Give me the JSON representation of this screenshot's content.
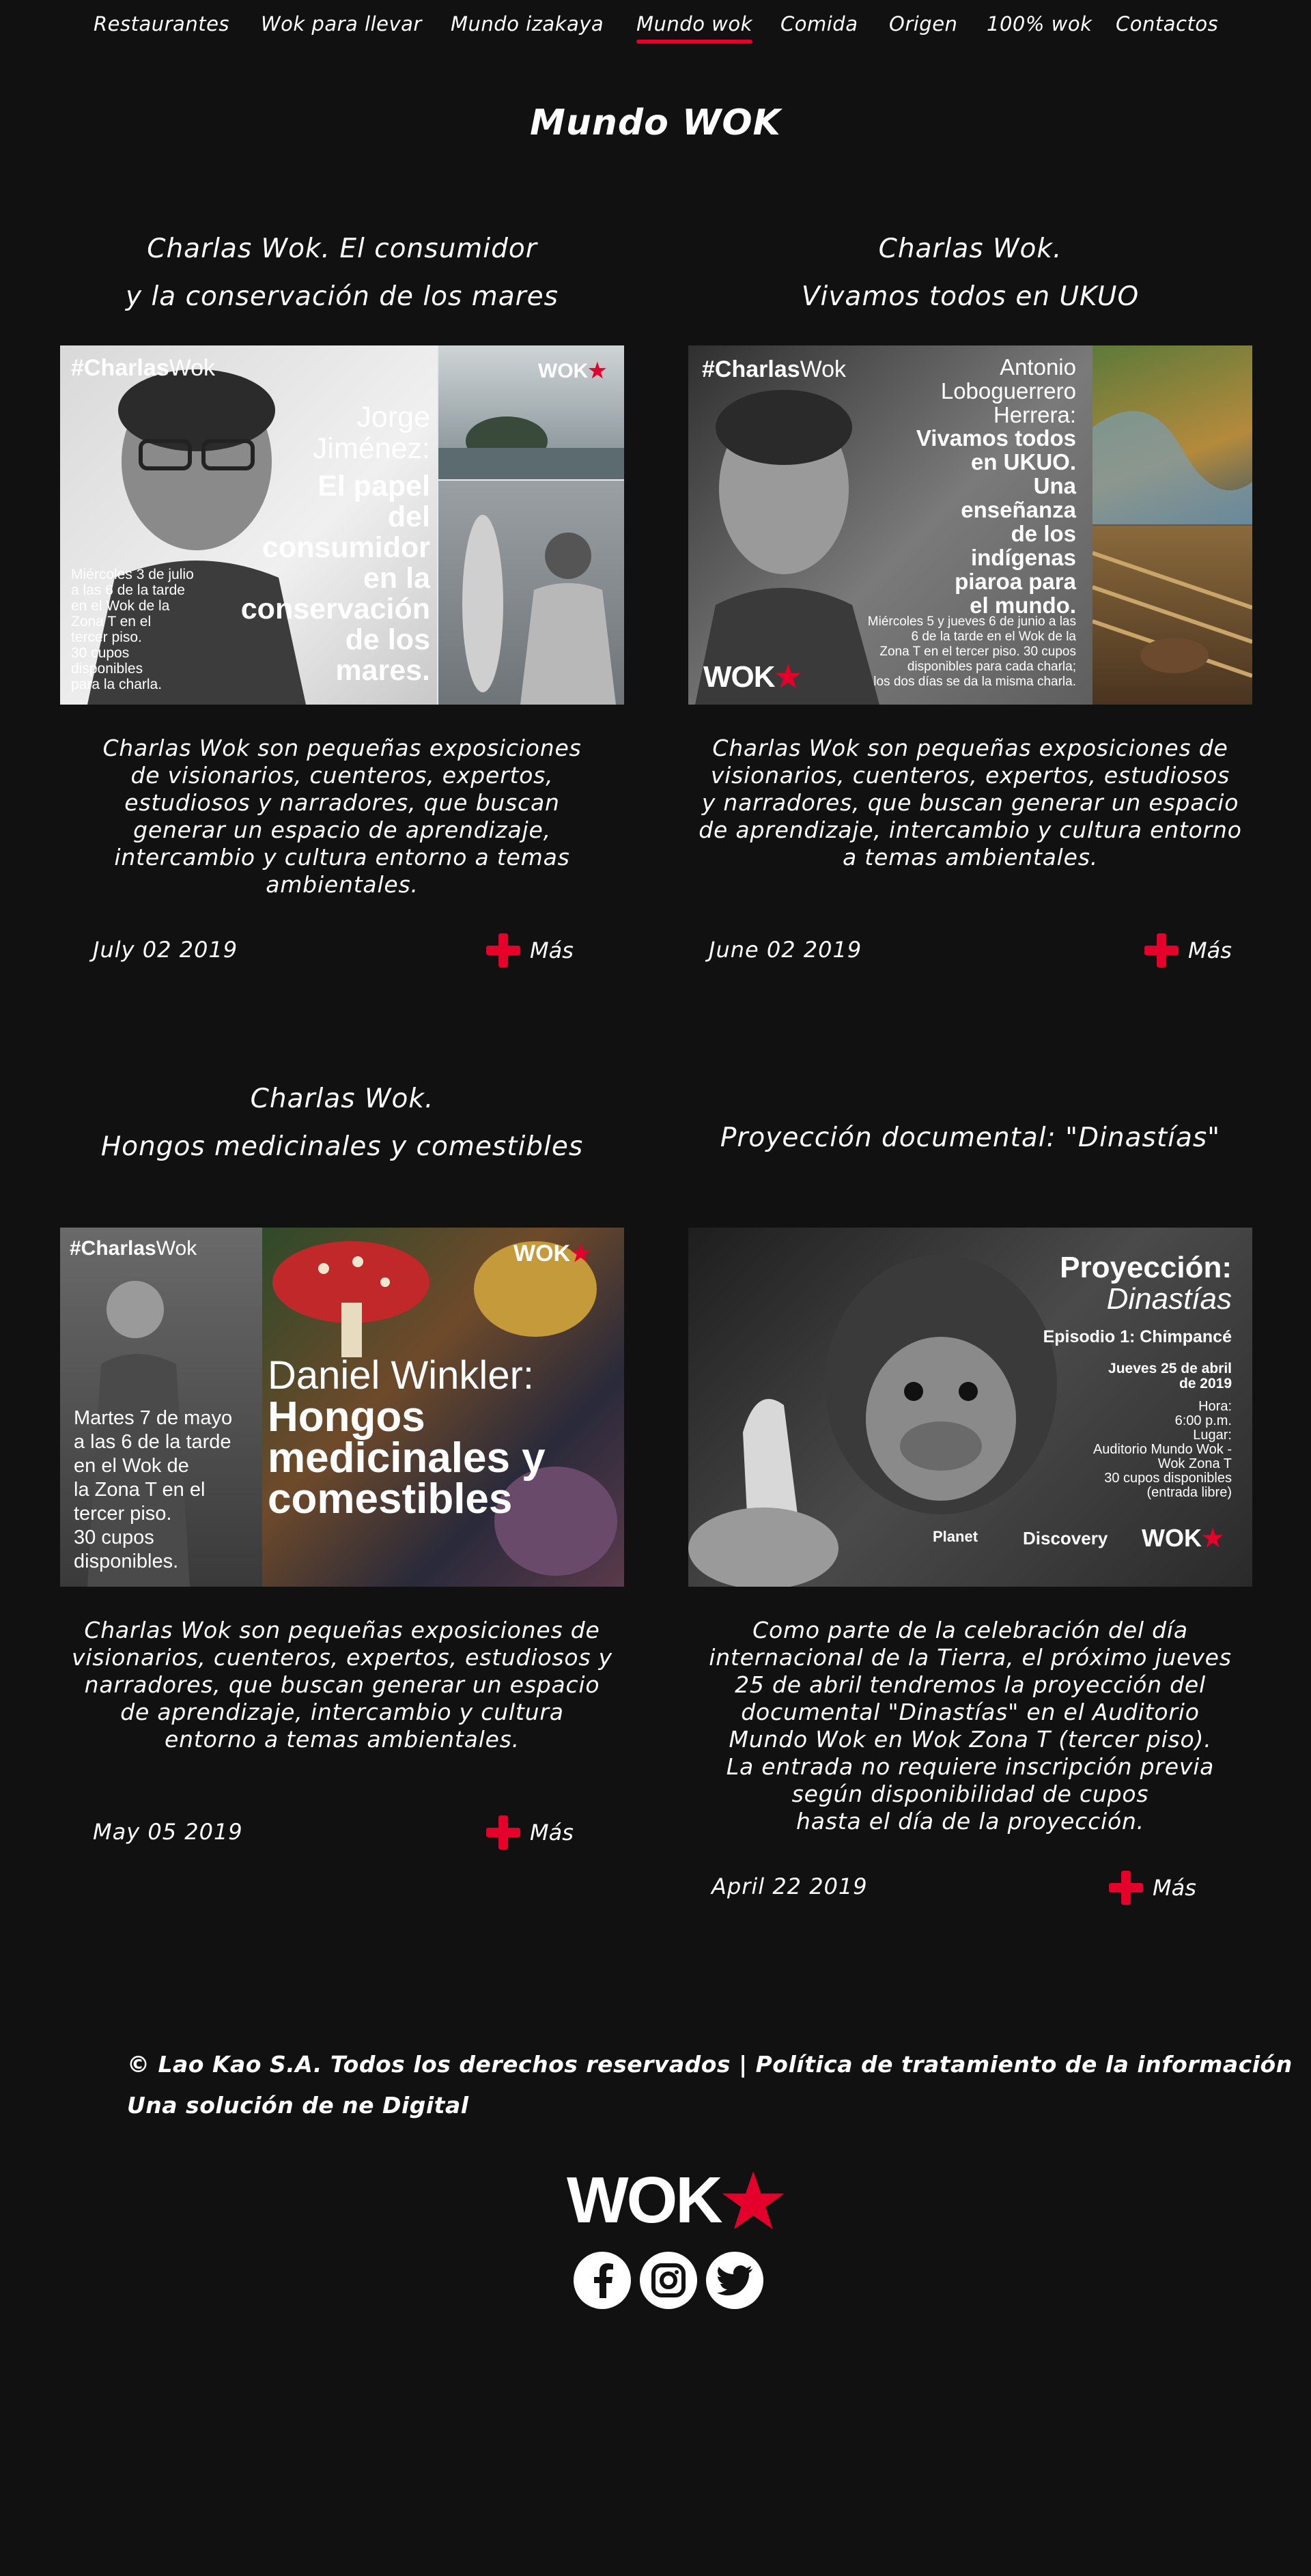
{
  "nav": {
    "items": [
      {
        "label": "Restaurantes"
      },
      {
        "label": "Wok para llevar"
      },
      {
        "label": "Mundo izakaya"
      },
      {
        "label": "Mundo wok",
        "active": true
      },
      {
        "label": "Comida"
      },
      {
        "label": "Origen"
      },
      {
        "label": "100% wok"
      },
      {
        "label": "Contactos"
      }
    ]
  },
  "page": {
    "title": "Mundo WOK"
  },
  "brand": {
    "accent": "#e4002b",
    "background": "#111111",
    "logo": "WOK"
  },
  "cards": [
    {
      "title_lines": [
        "Charlas Wok. El consumidor",
        "y la conservación de los mares"
      ],
      "poster": {
        "tag_bold": "#Charlas",
        "tag_light": "Wok",
        "logo": "WOK",
        "headline_light": [
          "Jorge",
          "Jiménez:"
        ],
        "headline_bold": [
          "El papel",
          "del",
          "consumidor",
          "en la",
          "conservación",
          "de los",
          "mares."
        ],
        "details": [
          "Miércoles 3 de julio",
          "a las 6 de la tarde",
          "en el Wok de la",
          "Zona T en el",
          "tercer piso.",
          "30 cupos",
          "disponibles",
          "para la charla."
        ]
      },
      "desc_lines": [
        "Charlas Wok son pequeñas exposiciones",
        "de visionarios, cuenteros, expertos,",
        "estudiosos y narradores, que buscan",
        "generar un espacio de aprendizaje,",
        "intercambio y cultura entorno a temas",
        "ambientales."
      ],
      "date": "July 02 2019",
      "more": "Más"
    },
    {
      "title_lines": [
        "Charlas Wok.",
        "Vivamos todos en UKUO"
      ],
      "poster": {
        "tag_bold": "#Charlas",
        "tag_light": "Wok",
        "logo": "WOK",
        "headline_light": [
          "Antonio",
          "Loboguerrero",
          "Herrera:"
        ],
        "headline_bold": [
          "Vivamos todos",
          "en UKUO.",
          "Una",
          "enseñanza",
          "de los",
          "indígenas",
          "piaroa para",
          "el mundo."
        ],
        "details": [
          "Miércoles 5 y jueves 6 de junio a las",
          "6 de la tarde en el Wok de la",
          "Zona T en el tercer piso. 30 cupos",
          "disponibles para cada charla;",
          "los dos días se da la misma charla."
        ]
      },
      "desc_lines": [
        "Charlas Wok son pequeñas exposiciones de",
        "visionarios, cuenteros, expertos, estudiosos",
        "y narradores, que buscan generar un espacio",
        "de aprendizaje, intercambio y cultura entorno",
        "a temas ambientales."
      ],
      "date": "June 02 2019",
      "more": "Más"
    },
    {
      "title_lines": [
        "Charlas Wok.",
        "Hongos medicinales y comestibles"
      ],
      "poster": {
        "tag_bold": "#Charlas",
        "tag_light": "Wok",
        "logo": "WOK",
        "headline_light": [
          "Daniel Winkler:"
        ],
        "headline_bold": [
          "Hongos",
          "medicinales y",
          "comestibles"
        ],
        "details": [
          "Martes 7 de mayo",
          "a las 6 de la tarde",
          "en el Wok de",
          "la Zona T en el",
          "tercer piso.",
          "30 cupos",
          "disponibles."
        ]
      },
      "desc_lines": [
        "Charlas Wok son pequeñas exposiciones de",
        "visionarios, cuenteros, expertos, estudiosos y",
        "narradores, que buscan generar un espacio",
        "de aprendizaje, intercambio y cultura",
        "entorno a temas ambientales."
      ],
      "date": "May 05 2019",
      "more": "Más"
    },
    {
      "title_lines": [
        "Proyección documental: \"Dinastías\""
      ],
      "poster": {
        "headline_light": [
          "Proyección:"
        ],
        "headline_italic": "Dinastías",
        "episode": "Episodio 1: Chimpancé",
        "date_lines": [
          "Jueves 25 de abril",
          "de 2019"
        ],
        "details": [
          "Hora:",
          "6:00 p.m.",
          "Lugar:",
          "Auditorio Mundo Wok -",
          "Wok Zona T",
          "30 cupos disponibles",
          "(entrada libre)"
        ],
        "partner_1": "Planet",
        "partner_2": "Discovery",
        "logo": "WOK"
      },
      "desc_lines": [
        "Como parte de la celebración del día",
        "internacional de la Tierra, el próximo jueves",
        "25 de abril tendremos la proyección del",
        "documental  \"Dinastías\" en el Auditorio",
        "Mundo Wok en Wok Zona T  (tercer piso).",
        "La entrada no requiere inscripción  previa",
        "según disponibilidad de cupos",
        "hasta el día de la proyección."
      ],
      "date": "April 22 2019",
      "more": "Más"
    }
  ],
  "footer": {
    "copyright": "© Lao Kao S.A. Todos los derechos reservados | Política de tratamiento de la información",
    "credit": "Una solución de ne Digital",
    "logo": "WOK",
    "social": [
      "facebook-icon",
      "instagram-icon",
      "twitter-icon"
    ]
  }
}
